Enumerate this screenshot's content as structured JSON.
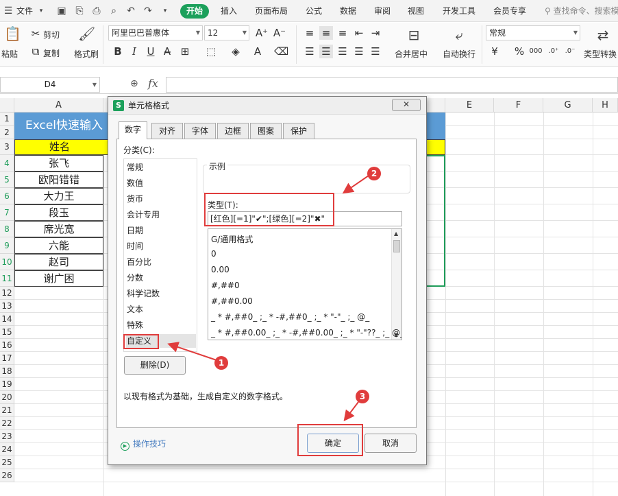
{
  "menu": {
    "file": "文件",
    "tabs": [
      "开始",
      "插入",
      "页面布局",
      "公式",
      "数据",
      "审阅",
      "视图",
      "开发工具",
      "会员专享"
    ],
    "search_placeholder": "查找命令、搜索模"
  },
  "ribbon": {
    "paste": "粘贴",
    "cut": "剪切",
    "copy": "复制",
    "format_painter": "格式刷",
    "font_name": "阿里巴巴普惠体",
    "font_size": "12",
    "merge_center": "合并居中",
    "wrap_text": "自动换行",
    "number_format": "常规",
    "type_convert": "类型转换"
  },
  "formula_bar": {
    "cell_ref": "D4",
    "fx": "fx"
  },
  "sheet": {
    "columns": [
      "A",
      "E",
      "F",
      "G",
      "H"
    ],
    "rows": [
      "1",
      "2",
      "3",
      "4",
      "5",
      "6",
      "7",
      "8",
      "9",
      "10",
      "11",
      "12",
      "13",
      "14",
      "15",
      "16",
      "17",
      "18",
      "19",
      "20",
      "21",
      "22",
      "23",
      "24",
      "25",
      "26"
    ],
    "title": "Excel快速输入",
    "header": "姓名",
    "names": [
      "张飞",
      "欧阳错错",
      "大力王",
      "段玉",
      "席光宽",
      "六能",
      "赵司",
      "谢广困"
    ]
  },
  "dialog": {
    "title": "单元格格式",
    "close": "✕",
    "tabs": [
      "数字",
      "对齐",
      "字体",
      "边框",
      "图案",
      "保护"
    ],
    "category_label": "分类(C):",
    "categories": [
      "常规",
      "数值",
      "货币",
      "会计专用",
      "日期",
      "时间",
      "百分比",
      "分数",
      "科学记数",
      "文本",
      "特殊",
      "自定义"
    ],
    "sample_label": "示例",
    "type_label": "类型(T):",
    "type_value": "[红色][=1]\"✔\";[绿色][=2]\"✖\"",
    "formats": [
      "G/通用格式",
      "0",
      "0.00",
      "#,##0",
      "#,##0.00",
      "_ * #,##0_ ;_ * -#,##0_ ;_ * \"-\"_ ;_ @_",
      "_ * #,##0.00_ ;_ * -#,##0.00_ ;_ * \"-\"??_ ;_ @_"
    ],
    "delete_button": "删除(D)",
    "description": "以现有格式为基础，生成自定义的数字格式。",
    "tips": "操作技巧",
    "ok_button": "确定",
    "cancel_button": "取消"
  },
  "annotations": [
    "1",
    "2",
    "3"
  ],
  "colors": {
    "accent_green": "#1ca05b",
    "title_blue": "#5b9bd5",
    "header_yellow": "#ffff00",
    "annotation_red": "#e03c3c"
  }
}
